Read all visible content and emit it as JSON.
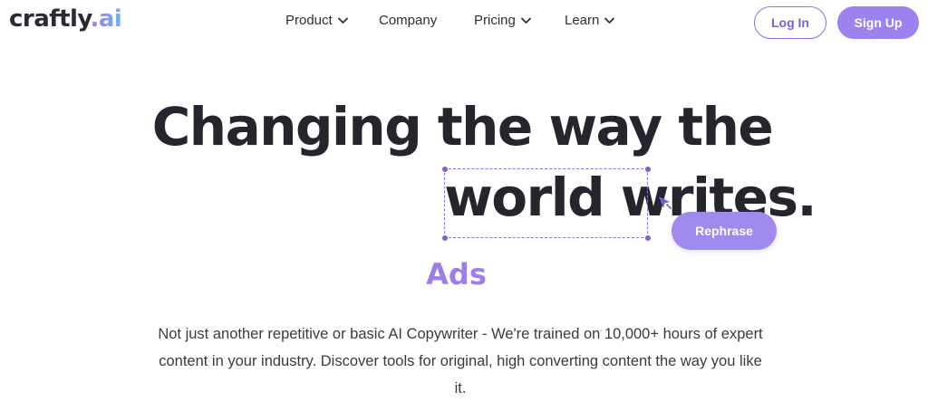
{
  "brand": {
    "name": "craftly",
    "suffix": ".ai",
    "accent_gradient": [
      "#9f7bea",
      "#6fb3f0"
    ]
  },
  "nav": {
    "items": [
      {
        "label": "Product",
        "has_dropdown": true
      },
      {
        "label": "Company",
        "has_dropdown": false
      },
      {
        "label": "Pricing",
        "has_dropdown": true
      },
      {
        "label": "Learn",
        "has_dropdown": true
      }
    ],
    "login_label": "Log In",
    "signup_label": "Sign Up"
  },
  "hero": {
    "line1": "Changing the way the",
    "line2": "world writes.",
    "rephrase_label": "Rephrase",
    "rotating_word": "Ads",
    "description": "Not just another repetitive or basic AI Copywriter - We're trained on 10,000+ hours of expert content in your industry. Discover tools for original, high converting content the way you like it."
  },
  "colors": {
    "accent": "#9c82ee",
    "accent_dark": "#7c5fd6",
    "heading": "#25252d",
    "text": "#3a3a44"
  },
  "icons": {
    "dropdown": "chevron-down-icon",
    "cursor": "pointer-arrow-icon"
  }
}
